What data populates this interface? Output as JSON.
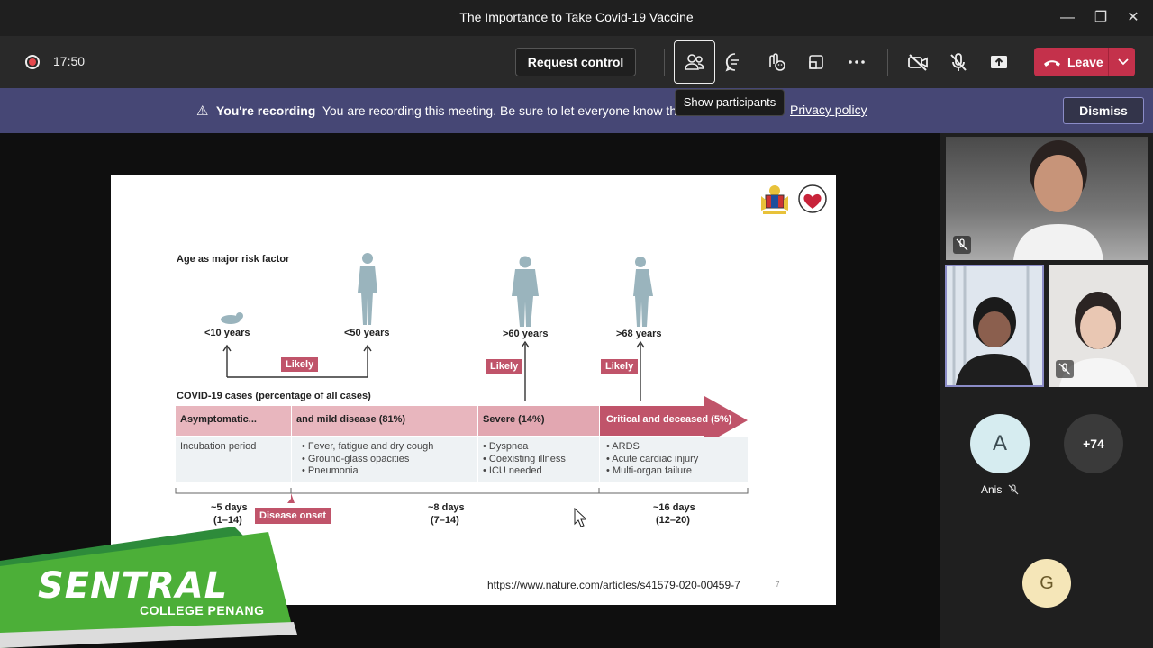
{
  "window": {
    "title": "The Importance to Take Covid-19 Vaccine"
  },
  "toolbar": {
    "timer": "17:50",
    "request_control_label": "Request control",
    "leave_label": "Leave"
  },
  "tooltip": {
    "text": "Show participants"
  },
  "banner": {
    "bold": "You're recording",
    "message": "You are recording this meeting. Be sure to let everyone know that the",
    "policy_link": "Privacy policy",
    "dismiss_label": "Dismiss"
  },
  "slide": {
    "heading": "Age as major risk factor",
    "ages": [
      "<10 years",
      "<50 years",
      ">60 years",
      ">68 years"
    ],
    "likely": "Likely",
    "cases_title": "COVID-19 cases (percentage of all cases)",
    "stages": [
      {
        "label": "Asymptomatic...",
        "items": [
          "Incubation period"
        ]
      },
      {
        "label": "and mild disease (81%)",
        "items": [
          "• Fever, fatigue and dry cough",
          "• Ground-glass opacities",
          "• Pneumonia"
        ]
      },
      {
        "label": "Severe (14%)",
        "items": [
          "• Dyspnea",
          "• Coexisting illness",
          "• ICU needed"
        ]
      },
      {
        "label": "Critical and deceased (5%)",
        "items": [
          "• ARDS",
          "• Acute cardiac injury",
          "• Multi-organ failure"
        ]
      }
    ],
    "durations": [
      {
        "main": "~5 days",
        "range": "(1–14)"
      },
      {
        "main": "~8 days",
        "range": "(7–14)"
      },
      {
        "main": "~16 days",
        "range": "(12–20)"
      }
    ],
    "disease_onset": "Disease onset",
    "url": "https://www.nature.com/articles/s41579-020-00459-7",
    "page": "7"
  },
  "branding": {
    "name": "SENTRAL",
    "sub": "COLLEGE PENANG"
  },
  "participants": {
    "named_avatar": {
      "initial": "A",
      "name": "Anis",
      "color": "#d6ecf0"
    },
    "overflow": "+74",
    "g_avatar": {
      "initial": "G",
      "color": "#f5e6b8"
    }
  },
  "colors": {
    "leave": "#c4314b",
    "banner": "#464775",
    "stage_header": "#e8b6be",
    "arrow": "#c0546a"
  }
}
